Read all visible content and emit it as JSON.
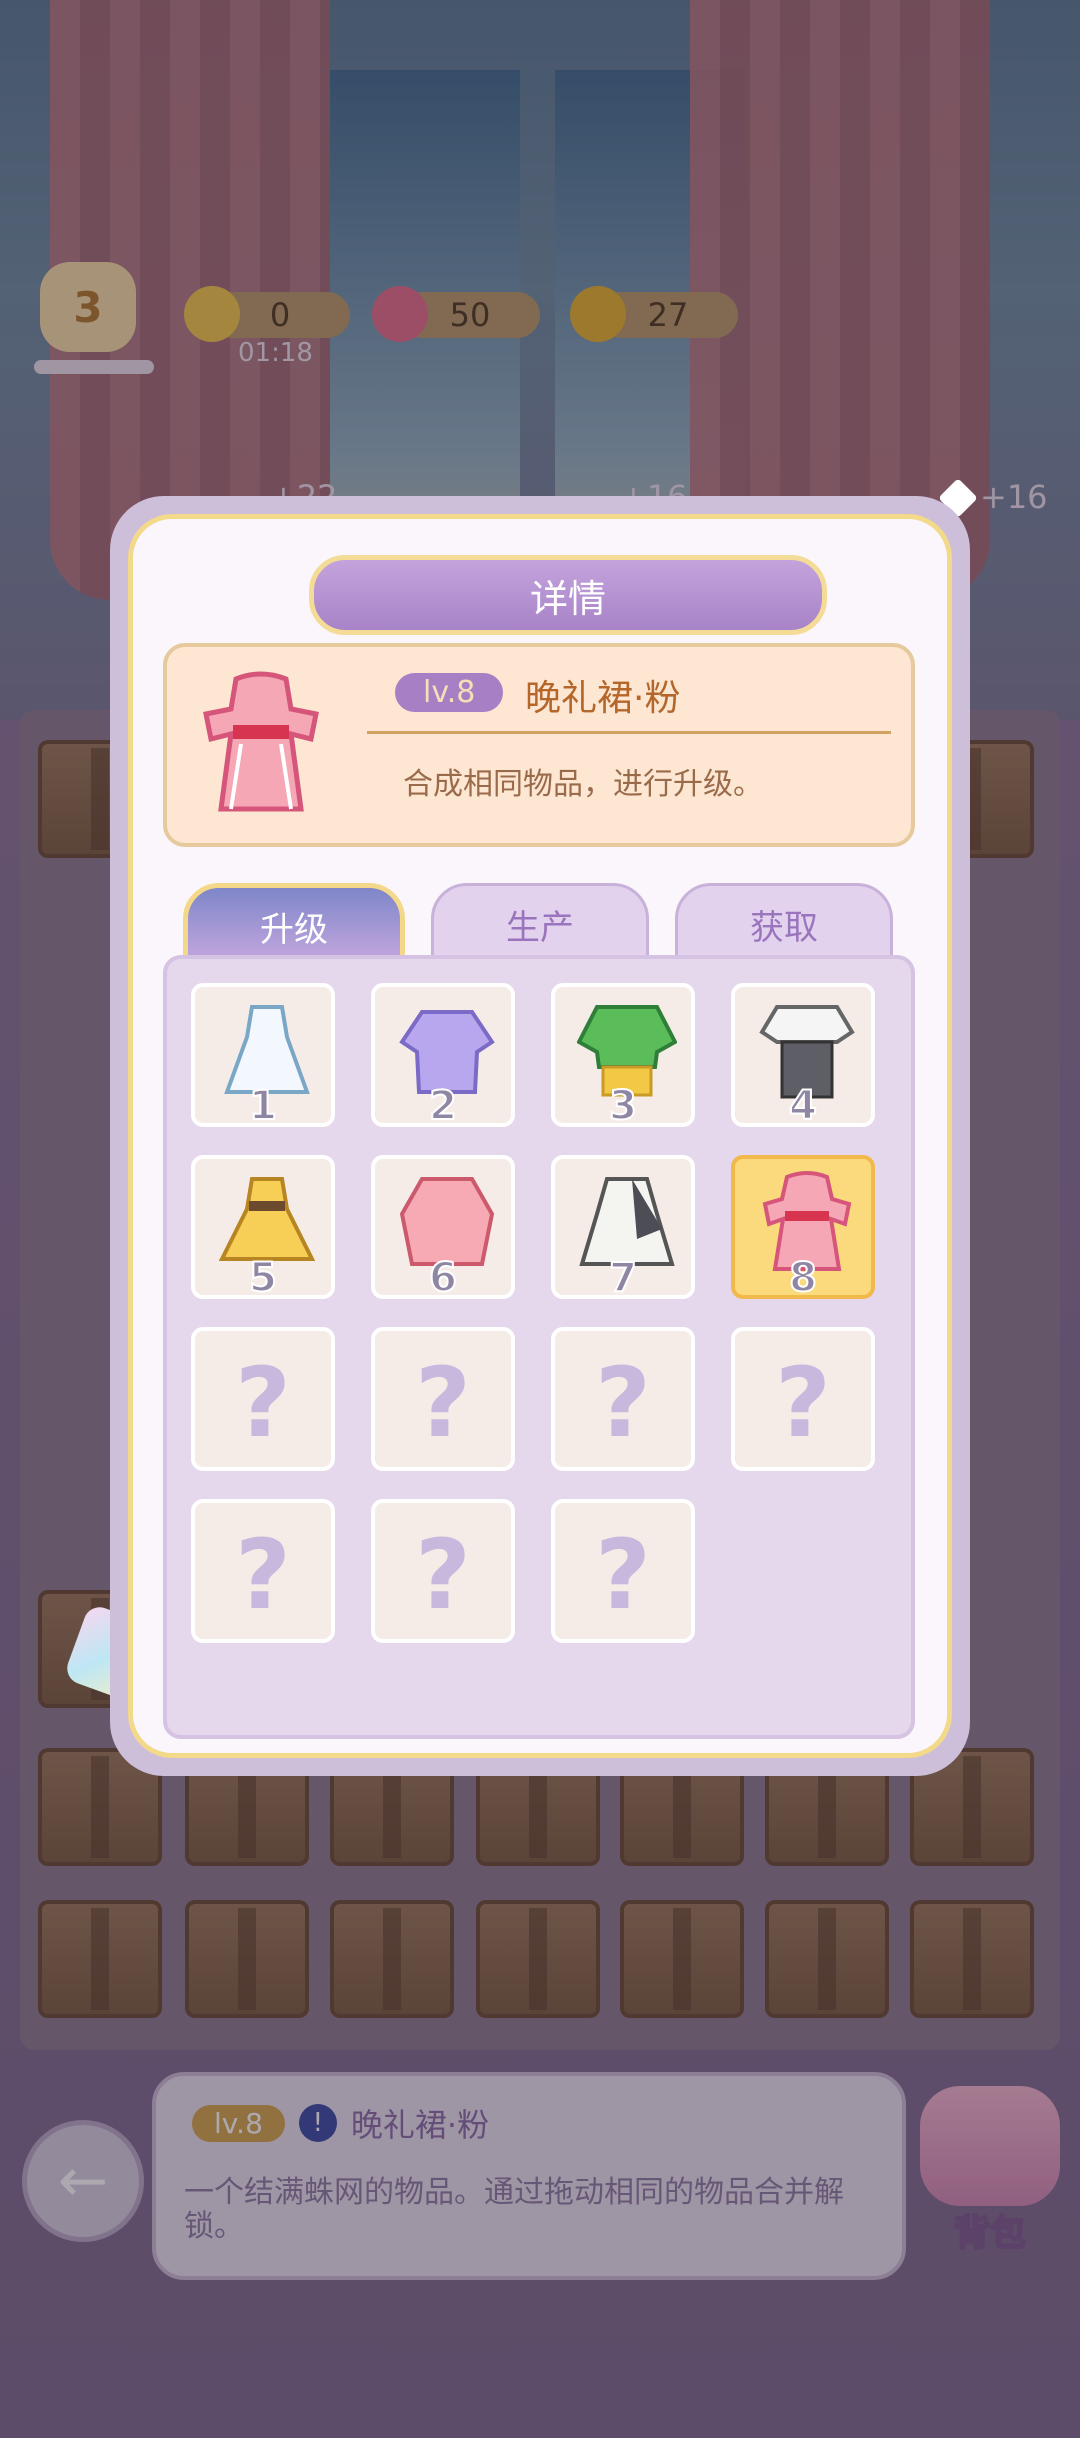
{
  "hud": {
    "player_level": "3",
    "energy": "0",
    "energy_timer": "01:18",
    "gems": "50",
    "coins": "27",
    "reward_left": "+22",
    "reward_mid": "+16",
    "reward_right": "+16"
  },
  "modal": {
    "title": "详情",
    "item": {
      "level": "lv.8",
      "name": "晚礼裙·粉",
      "description": "合成相同物品，进行升级。"
    },
    "tabs": [
      {
        "label": "升级",
        "active": true
      },
      {
        "label": "生产",
        "active": false
      },
      {
        "label": "获取",
        "active": false
      }
    ],
    "slots": [
      {
        "number": "1",
        "unlocked": true,
        "icon": "white-dress-icon"
      },
      {
        "number": "2",
        "unlocked": true,
        "icon": "purple-blouse-icon"
      },
      {
        "number": "3",
        "unlocked": true,
        "icon": "green-sweater-icon"
      },
      {
        "number": "4",
        "unlocked": true,
        "icon": "gray-skirt-outfit-icon"
      },
      {
        "number": "5",
        "unlocked": true,
        "icon": "yellow-dress-icon"
      },
      {
        "number": "6",
        "unlocked": true,
        "icon": "pink-coat-icon"
      },
      {
        "number": "7",
        "unlocked": true,
        "icon": "gray-white-gown-icon"
      },
      {
        "number": "8",
        "unlocked": true,
        "icon": "pink-evening-dress-icon",
        "selected": true
      },
      {
        "number": "?",
        "unlocked": false
      },
      {
        "number": "?",
        "unlocked": false
      },
      {
        "number": "?",
        "unlocked": false
      },
      {
        "number": "?",
        "unlocked": false
      },
      {
        "number": "?",
        "unlocked": false
      },
      {
        "number": "?",
        "unlocked": false
      },
      {
        "number": "?",
        "unlocked": false
      }
    ]
  },
  "info_bar": {
    "level": "lv.8",
    "name": "晚礼裙·粉",
    "description": "一个结满蛛网的物品。通过拖动相同的物品合并解锁。"
  },
  "bag_label": "背包",
  "colors": {
    "accent_purple": "#a883c8",
    "gold": "#f4dc97",
    "selected_slot": "#fbd97d"
  }
}
